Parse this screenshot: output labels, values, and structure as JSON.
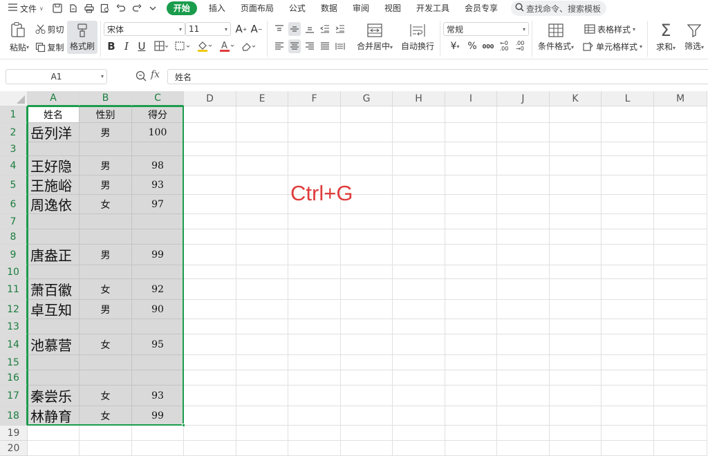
{
  "menu": {
    "file_label": "文件",
    "tabs": [
      "开始",
      "插入",
      "页面布局",
      "公式",
      "数据",
      "审阅",
      "视图",
      "开发工具",
      "会员专享"
    ],
    "search_placeholder": "查找命令、搜索模板"
  },
  "ribbon": {
    "paste": "粘贴",
    "cut": "剪切",
    "copy": "复制",
    "format_painter": "格式刷",
    "font_name": "宋体",
    "font_size": "11",
    "merge_center": "合并居中",
    "wrap_text": "自动换行",
    "number_format": "常规",
    "conditional_format": "条件格式",
    "table_style": "表格样式",
    "cell_style": "单元格样式",
    "sum": "求和",
    "filter": "筛选"
  },
  "formula_bar": {
    "name_box": "A1",
    "content": "姓名"
  },
  "sheet": {
    "columns": [
      "A",
      "B",
      "C",
      "D",
      "E",
      "F",
      "G",
      "H",
      "I",
      "J",
      "K",
      "L",
      "M"
    ],
    "rows": [
      "1",
      "2",
      "3",
      "4",
      "5",
      "6",
      "7",
      "8",
      "9",
      "10",
      "11",
      "12",
      "13",
      "14",
      "15",
      "16",
      "17",
      "18",
      "19",
      "20"
    ],
    "cells": [
      [
        "姓名",
        "性别",
        "得分"
      ],
      [
        "岳列洋",
        "男",
        "100"
      ],
      [
        "",
        "",
        ""
      ],
      [
        "王好隐",
        "男",
        "98"
      ],
      [
        "王施峪",
        "男",
        "93"
      ],
      [
        "周逸依",
        "女",
        "97"
      ],
      [
        "",
        "",
        ""
      ],
      [
        "",
        "",
        ""
      ],
      [
        "唐盎正",
        "男",
        "99"
      ],
      [
        "",
        "",
        ""
      ],
      [
        "萧百徽",
        "女",
        "92"
      ],
      [
        "卓互知",
        "男",
        "90"
      ],
      [
        "",
        "",
        ""
      ],
      [
        "池慕营",
        "女",
        "95"
      ],
      [
        "",
        "",
        ""
      ],
      [
        "",
        "",
        ""
      ],
      [
        "秦尝乐",
        "女",
        "93"
      ],
      [
        "林静育",
        "女",
        "99"
      ],
      [
        "",
        "",
        ""
      ],
      [
        "",
        "",
        ""
      ]
    ]
  },
  "annotation": "Ctrl+G",
  "colors": {
    "accent": "#1a9c4c",
    "annotation": "#e03c3c",
    "selection": "#d9d9d9"
  }
}
